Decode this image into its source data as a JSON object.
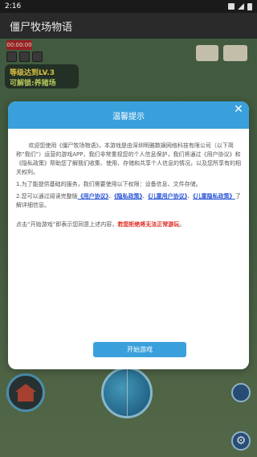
{
  "statusbar": {
    "time": "2:16",
    "icons": [
      "notification-icon",
      "location-icon",
      "signal-icon",
      "battery-icon"
    ]
  },
  "app": {
    "title": "僵尸牧场物语"
  },
  "game": {
    "timer": "00:00:00",
    "level_line1": "等级达到LV.3",
    "level_line2": "可解锁:养猪场"
  },
  "dialog": {
    "title": "温馨提示",
    "close_symbol": "✕",
    "para1": "欢迎您使用《僵尸牧场物语》，本游戏是由深圳明雅数娱网络科技有限公司（以下简称“我们”）运营的游戏APP，我们非常重视您的个人信息保护，我们将通过《用户协议》和《隐私政策》帮助您了解我们收集、使用、存储和共享个人信息的情况，以及您所享有的相关权利。",
    "para2": "1.为了能提供基础的服务，我们需要使用以下权限：设备信息、文件存储。",
    "para3_prefix": "2.您可以通过阅读完整版",
    "link_user_agreement": "《用户协议》",
    "sep": "、",
    "link_privacy": "《隐私政策》",
    "link_child_user_agreement": "《儿童用户协议》",
    "link_child_privacy": "《儿童隐私政策》",
    "para3_suffix": "了解详细信息。",
    "para4_prefix": "点击“开始游戏”即表示您同意上述内容，",
    "para4_warning": "若您拒绝将无法正常游玩",
    "para4_suffix": "。",
    "start_button": "开始游戏"
  },
  "colors": {
    "accent": "#3aa0dc",
    "link": "#2a55d6",
    "warning": "#e0221a"
  }
}
